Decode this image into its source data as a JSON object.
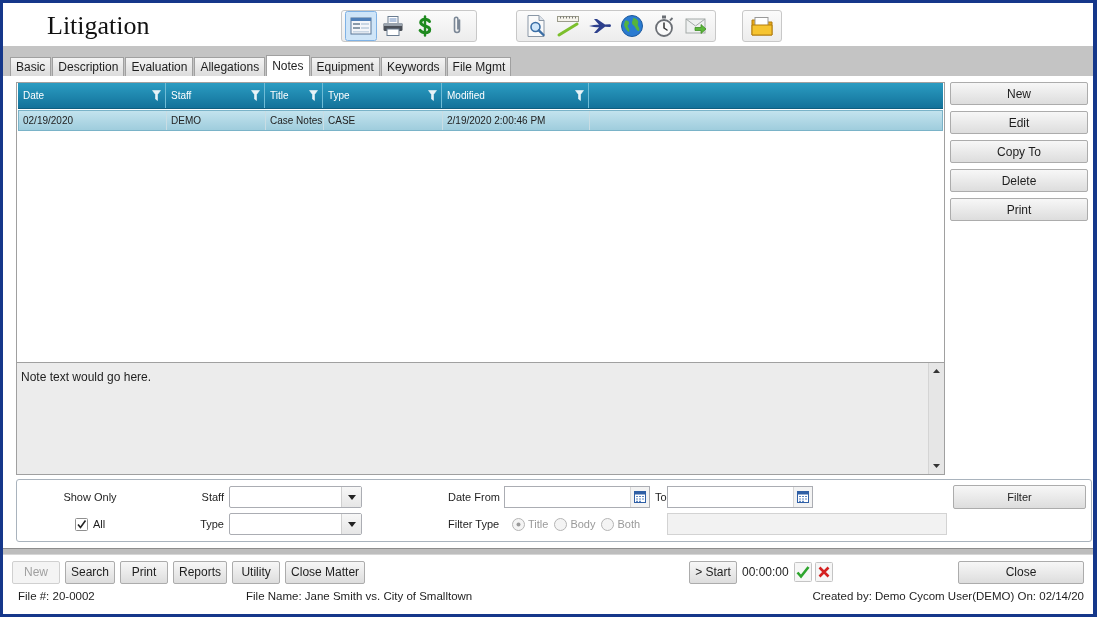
{
  "window": {
    "title": "Litigation"
  },
  "toolbar": {
    "groups": [
      {
        "buttons": [
          {
            "kind": "form",
            "selected": true
          },
          {
            "kind": "printer",
            "selected": false
          },
          {
            "kind": "dollar",
            "selected": false
          },
          {
            "kind": "paperclip",
            "selected": false
          }
        ]
      },
      {
        "buttons": [
          {
            "kind": "magnifier",
            "selected": false
          },
          {
            "kind": "ruler",
            "selected": false
          },
          {
            "kind": "airplane",
            "selected": false
          },
          {
            "kind": "globe",
            "selected": false
          },
          {
            "kind": "stopwatch",
            "selected": false
          },
          {
            "kind": "envelope",
            "selected": false
          }
        ]
      },
      {
        "buttons": [
          {
            "kind": "folder",
            "selected": false
          }
        ]
      }
    ]
  },
  "tabs": [
    {
      "label": "Basic",
      "selected": false
    },
    {
      "label": "Description",
      "selected": false
    },
    {
      "label": "Evaluation",
      "selected": false
    },
    {
      "label": "Allegations",
      "selected": false
    },
    {
      "label": "Notes",
      "selected": true
    },
    {
      "label": "Equipment",
      "selected": false
    },
    {
      "label": "Keywords",
      "selected": false
    },
    {
      "label": "File Mgmt",
      "selected": false
    }
  ],
  "grid": {
    "columns": [
      "Date",
      "Staff",
      "Title",
      "Type",
      "Modified"
    ],
    "rows": [
      {
        "selected": true,
        "cells": [
          "02/19/2020",
          "DEMO",
          "Case Notes",
          "CASE",
          "2/19/2020 2:00:46 PM"
        ]
      }
    ]
  },
  "note": {
    "text": "Note text would go here."
  },
  "side_buttons": [
    "New",
    "Edit",
    "Copy To",
    "Delete",
    "Print"
  ],
  "filter": {
    "show_only": "Show Only",
    "all": {
      "label": "All",
      "checked": true
    },
    "staff": {
      "label": "Staff"
    },
    "type": {
      "label": "Type"
    },
    "date_from": {
      "label": "Date From"
    },
    "date_to": {
      "label": "To"
    },
    "filter_type": {
      "label": "Filter Type",
      "options": [
        {
          "label": "Title",
          "selected": true,
          "disabled": true
        },
        {
          "label": "Body",
          "selected": false,
          "disabled": true
        },
        {
          "label": "Both",
          "selected": false,
          "disabled": true
        }
      ]
    },
    "text_field": {
      "disabled": true
    },
    "button": "Filter"
  },
  "action_bar": {
    "buttons": [
      {
        "label": "New",
        "disabled": true
      },
      {
        "label": "Search",
        "disabled": false
      },
      {
        "label": "Print",
        "disabled": false
      },
      {
        "label": "Reports",
        "disabled": false
      },
      {
        "label": "Utility",
        "disabled": false
      },
      {
        "label": "Close Matter",
        "disabled": false
      }
    ],
    "timer": {
      "start": "> Start",
      "elapsed": "00:00:00"
    },
    "close": "Close"
  },
  "status_bar": {
    "file_number": "File #: 20-0002",
    "file_name": "File Name: Jane Smith vs. City of Smalltown",
    "created": "Created by: Demo Cycom User(DEMO) On: 02/14/20"
  }
}
